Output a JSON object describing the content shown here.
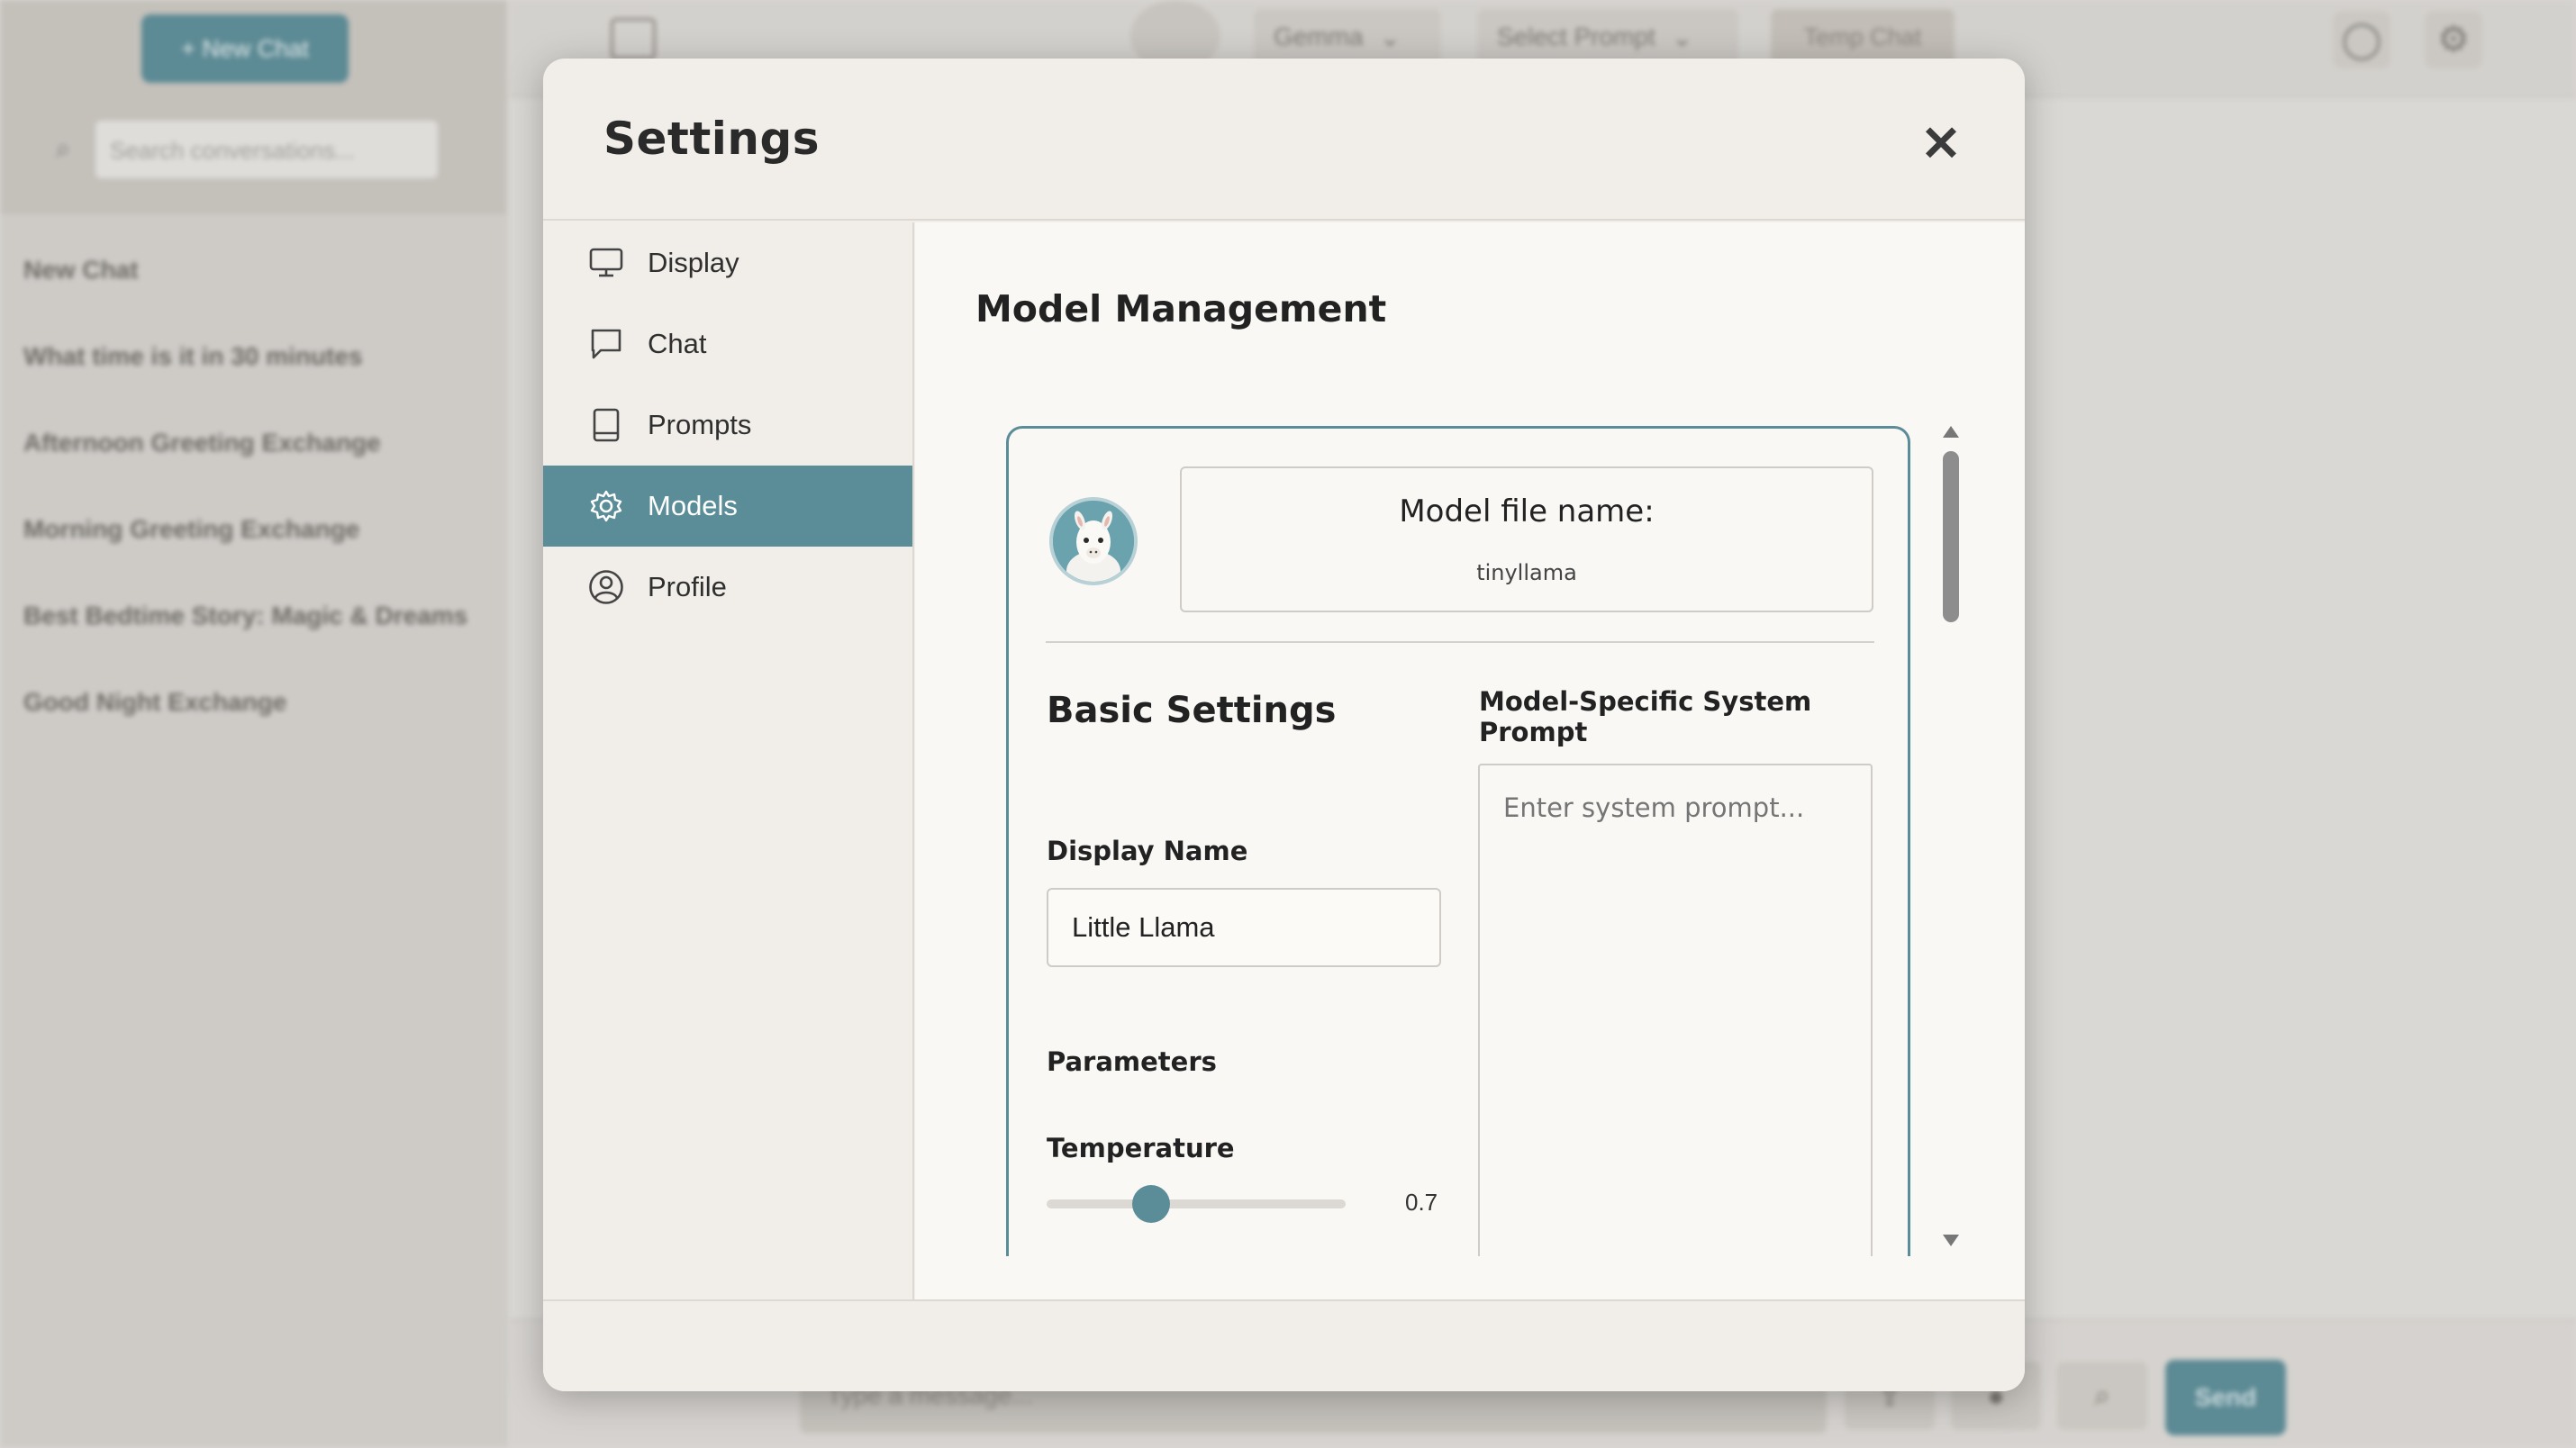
{
  "background": {
    "new_chat_label": "+ New Chat",
    "search_placeholder": "Search conversations...",
    "conversations": [
      "New Chat",
      "What time is it in 30 minutes",
      "Afternoon Greeting Exchange",
      "Morning Greeting Exchange",
      "Best Bedtime Story: Magic & Dreams",
      "Good Night Exchange"
    ],
    "model_select": "Gemma",
    "prompt_select": "Select Prompt",
    "temp_chat_label": "Temp Chat",
    "message_placeholder": "Type a message...",
    "send_label": "Send"
  },
  "modal": {
    "title": "Settings",
    "close_glyph": "✕",
    "nav": [
      {
        "label": "Display",
        "icon": "monitor-icon",
        "active": false
      },
      {
        "label": "Chat",
        "icon": "chat-bubble-icon",
        "active": false
      },
      {
        "label": "Prompts",
        "icon": "book-icon",
        "active": false
      },
      {
        "label": "Models",
        "icon": "gear-icon",
        "active": true
      },
      {
        "label": "Profile",
        "icon": "user-circle-icon",
        "active": false
      }
    ],
    "section_title": "Model Management",
    "model_card": {
      "avatar_icon": "llama-avatar",
      "file_name_label": "Model file name:",
      "file_name_value": "tinyllama",
      "basic_settings_title": "Basic Settings",
      "system_prompt_title": "Model-Specific System Prompt",
      "system_prompt_placeholder": "Enter system prompt...",
      "display_name_label": "Display Name",
      "display_name_value": "Little Llama",
      "parameters_label": "Parameters",
      "temperature_label": "Temperature",
      "temperature_value": "0.7",
      "temperature_min": 0,
      "temperature_max": 2
    }
  },
  "colors": {
    "accent": "#5b8d98",
    "modal_bg": "#f1eee9",
    "content_bg": "#f9f8f5"
  }
}
